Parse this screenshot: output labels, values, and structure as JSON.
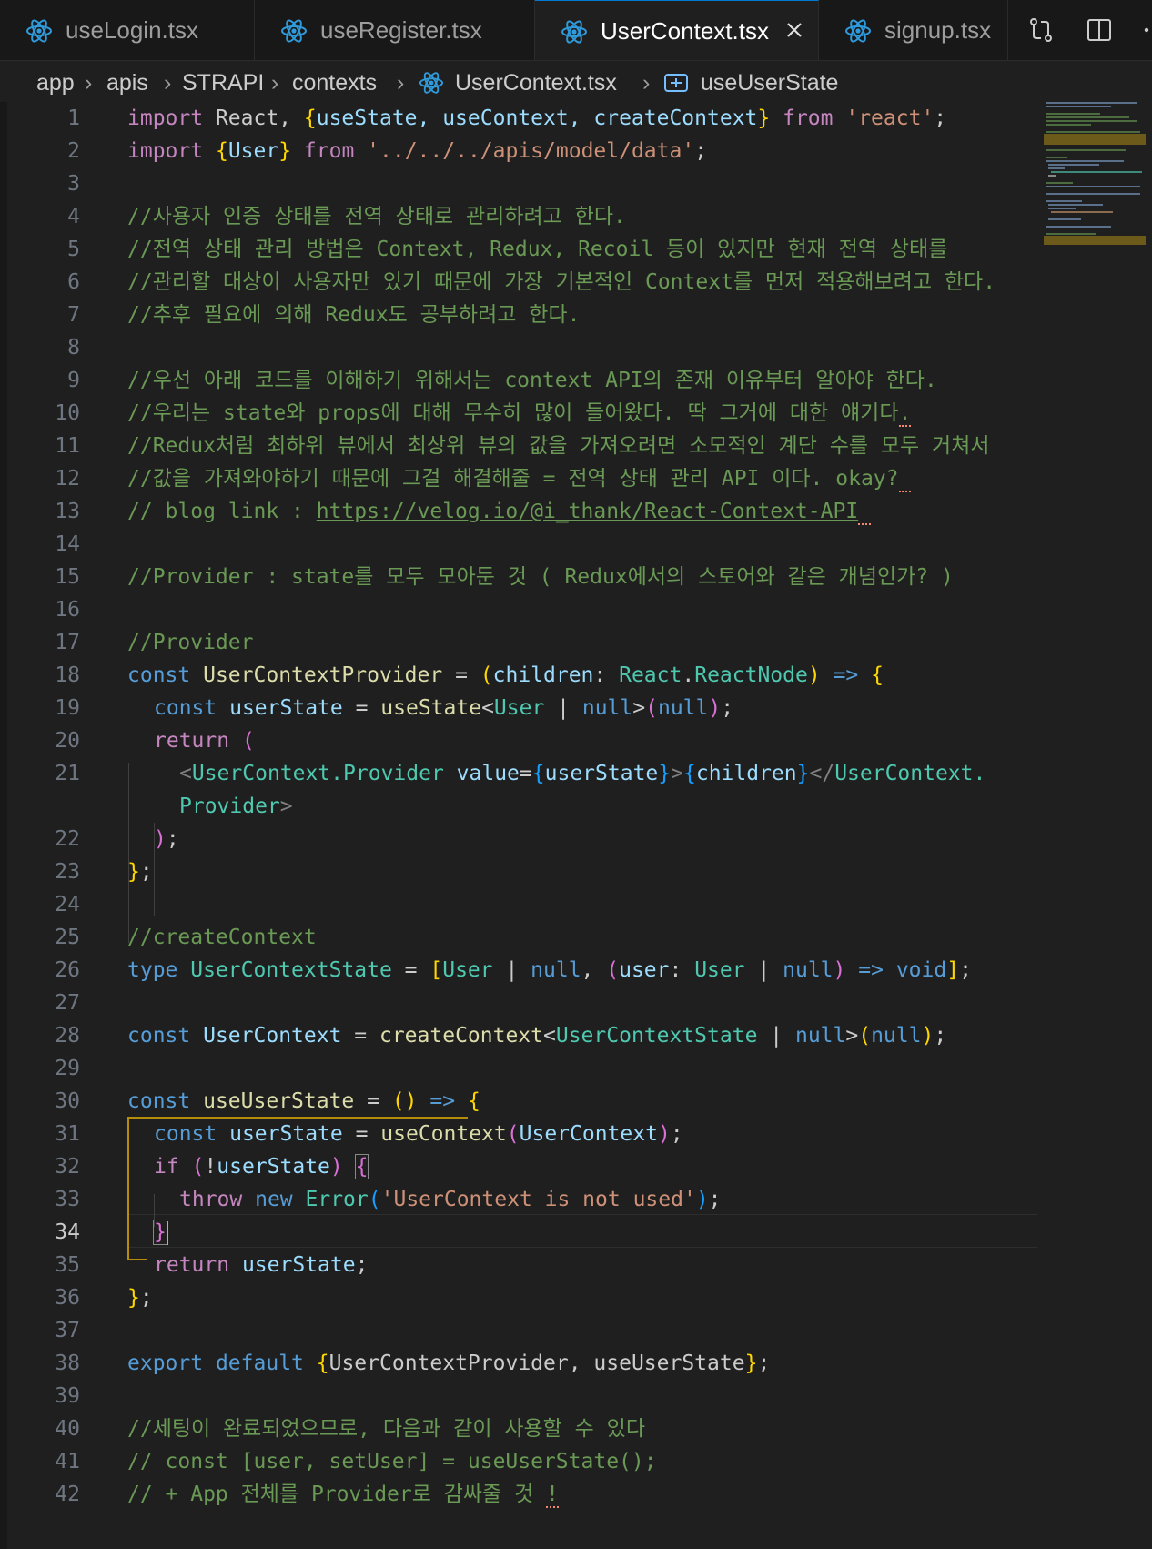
{
  "tabs": [
    {
      "label": "useLogin.tsx",
      "active": false
    },
    {
      "label": "useRegister.tsx",
      "active": false
    },
    {
      "label": "UserContext.tsx",
      "active": true
    },
    {
      "label": "signup.tsx",
      "active": false
    }
  ],
  "tab_icons": {
    "file": "react-icon",
    "close": "close-icon",
    "actions": [
      "source-control-compare-icon",
      "split-editor-icon",
      "more-actions-icon"
    ]
  },
  "breadcrumb": [
    "app",
    "apis",
    "STRAPI",
    "contexts",
    "UserContext.tsx",
    "useUserState"
  ],
  "editor": {
    "active_line": 34,
    "line_numbers": [
      "1",
      "2",
      "3",
      "4",
      "5",
      "6",
      "7",
      "8",
      "9",
      "10",
      "11",
      "12",
      "13",
      "14",
      "15",
      "16",
      "17",
      "18",
      "19",
      "20",
      "21",
      "",
      "22",
      "23",
      "24",
      "25",
      "26",
      "27",
      "28",
      "29",
      "30",
      "31",
      "32",
      "33",
      "34",
      "35",
      "36",
      "37",
      "38",
      "39",
      "40",
      "41",
      "42"
    ],
    "code": {
      "l1": [
        "import",
        " React, ",
        "{",
        "useState, useContext, createContext",
        "}",
        " ",
        "from",
        " ",
        "'react'",
        ";"
      ],
      "l2": [
        "import",
        " ",
        "{",
        "User",
        "}",
        " ",
        "from",
        " ",
        "'../../../apis/model/data'",
        ";"
      ],
      "l4": "//사용자 인증 상태를 전역 상태로 관리하려고 한다.",
      "l5": "//전역 상태 관리 방법은 Context, Redux, Recoil 등이 있지만 현재 전역 상태를",
      "l6": "//관리할 대상이 사용자만 있기 때문에 가장 기본적인 Context를 먼저 적용해보려고 한다.",
      "l7": "//추후 필요에 의해 Redux도 공부하려고 한다.",
      "l9": "//우선 아래 코드를 이해하기 위해서는 context API의 존재 이유부터 알아야 한다.",
      "l10": [
        "//우리는 state와 props에 대해 무수히 많이 들어왔다. 딱 그거에 대한 얘기다",
        "."
      ],
      "l11": "//Redux처럼 최하위 뷰에서 최상위 뷰의 값을 가져오려면 소모적인 계단 수를 모두 거쳐서",
      "l12": [
        "//값을 가져와야하기 때문에 그걸 해결해줄 = 전역 상태 관리 API 이다. okay?",
        " "
      ],
      "l13": [
        "// blog link : ",
        "https://velog.io/@i_thank/React-Context-API",
        " "
      ],
      "l15": "//Provider : state를 모두 모아둔 것 ( Redux에서의 스토어와 같은 개념인가? )",
      "l17": "//Provider",
      "l18": [
        "const",
        " ",
        "UserContextProvider",
        " = ",
        "(",
        "children",
        ": ",
        "React",
        ".",
        "ReactNode",
        ")",
        " ",
        "=>",
        " ",
        "{"
      ],
      "l19": [
        "const",
        " ",
        "userState",
        " = ",
        "useState",
        "<",
        "User",
        " | ",
        "null",
        ">",
        "(",
        "null",
        ")",
        ";"
      ],
      "l20": [
        "return",
        " ",
        "("
      ],
      "l21": [
        "<",
        "UserContext.Provider",
        " ",
        "value",
        "=",
        "{",
        "userState",
        "}",
        ">",
        "{",
        "children",
        "}",
        "</",
        "UserContext."
      ],
      "l21b": [
        "Provider",
        ">"
      ],
      "l22": [
        ")",
        ";"
      ],
      "l23": [
        "}",
        ";"
      ],
      "l25": "//createContext",
      "l26": [
        "type",
        " ",
        "UserContextState",
        " = ",
        "[",
        "User",
        " | ",
        "null",
        ", ",
        "(",
        "user",
        ": ",
        "User",
        " | ",
        "null",
        ")",
        " ",
        "=>",
        " ",
        "void",
        "]",
        ";"
      ],
      "l28": [
        "const",
        " ",
        "UserContext",
        " = ",
        "createContext",
        "<",
        "UserContextState",
        " | ",
        "null",
        ">",
        "(",
        "null",
        ")",
        ";"
      ],
      "l30": [
        "const",
        " ",
        "useUserState",
        " = ",
        "()",
        " ",
        "=>",
        " ",
        "{"
      ],
      "l31": [
        "const",
        " ",
        "userState",
        " = ",
        "useContext",
        "(",
        "UserContext",
        ")",
        ";"
      ],
      "l32": [
        "if",
        " ",
        "(",
        "!",
        "userState",
        ")",
        " ",
        "{"
      ],
      "l33": [
        "throw",
        " ",
        "new",
        " ",
        "Error",
        "(",
        "'UserContext is not used'",
        ")",
        ";"
      ],
      "l34": [
        "}"
      ],
      "l35": [
        "return",
        " ",
        "userState",
        ";"
      ],
      "l36": [
        "}",
        ";"
      ],
      "l38": [
        "export",
        " ",
        "default",
        " ",
        "{",
        "UserContextProvider, useUserState",
        "}",
        ";"
      ],
      "l40": "//세팅이 완료되었으므로, 다음과 같이 사용할 수 있다",
      "l41": "// const [user, setUser] = useUserState();",
      "l42": [
        "// + App 전체를 Provider로 감싸줄 것 ",
        "!"
      ]
    }
  },
  "colors": {
    "background": "#1f1f1f",
    "keyword": "#569cd6",
    "control": "#c586c0",
    "function": "#dcdcaa",
    "string": "#ce9178",
    "comment": "#6a9955",
    "type": "#4ec9b0",
    "bracket_gold": "#ffd700"
  }
}
